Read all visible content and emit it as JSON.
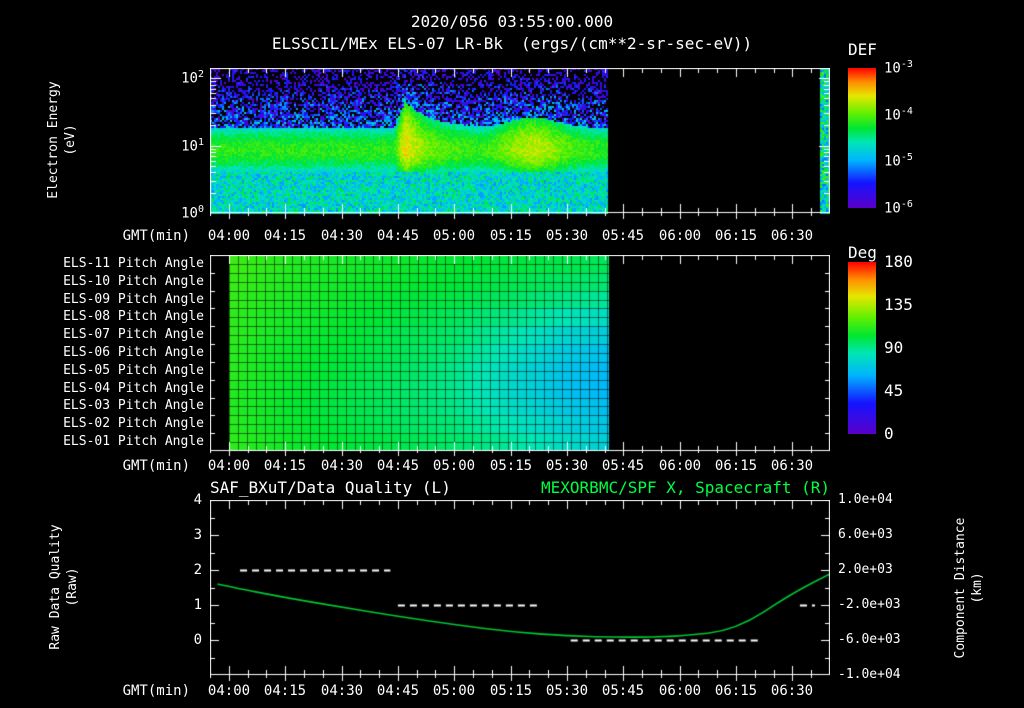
{
  "colors": {
    "background": "#000000",
    "foreground": "#ffffff",
    "accent_green": "#00ff41",
    "curve_green": "#00c832",
    "below_range": "#020208",
    "colormap_stops": [
      {
        "t": 0.0,
        "c": "#5a00c8"
      },
      {
        "t": 0.18,
        "c": "#1414ff"
      },
      {
        "t": 0.34,
        "c": "#00b4ff"
      },
      {
        "t": 0.47,
        "c": "#00e6b4"
      },
      {
        "t": 0.57,
        "c": "#00e632"
      },
      {
        "t": 0.68,
        "c": "#64f000"
      },
      {
        "t": 0.8,
        "c": "#e6e600"
      },
      {
        "t": 0.9,
        "c": "#ff8c00"
      },
      {
        "t": 1.0,
        "c": "#ff0000"
      }
    ]
  },
  "header": {
    "datetime": "2020/056 03:55:00.000",
    "title": "ELSSCIL/MEx ELS-07 LR-Bk",
    "units": "(ergs/(cm**2-sr-sec-eV))"
  },
  "time_axis": {
    "label": "GMT(min)",
    "start_offset_min": -5,
    "end_offset_min": 160,
    "major_tick_interval_min": 15,
    "minor_tick_interval_min": 5,
    "ticks": [
      "04:00",
      "04:15",
      "04:30",
      "04:45",
      "05:00",
      "05:15",
      "05:30",
      "05:45",
      "06:00",
      "06:15",
      "06:30"
    ]
  },
  "spectrogram_panel": {
    "ylabel_line1": "Electron Energy",
    "ylabel_line2": "(eV)",
    "ytick_base": "10",
    "ytick_exponents": [
      "2",
      "1",
      "0"
    ],
    "colorbar_title": "DEF",
    "colorbar_tick_base": "10",
    "colorbar_tick_exponents": [
      "-3",
      "-4",
      "-5",
      "-6"
    ]
  },
  "pitch_panel": {
    "row_labels": [
      "ELS-11 Pitch Angle",
      "ELS-10 Pitch Angle",
      "ELS-09 Pitch Angle",
      "ELS-08 Pitch Angle",
      "ELS-07 Pitch Angle",
      "ELS-06 Pitch Angle",
      "ELS-05 Pitch Angle",
      "ELS-04 Pitch Angle",
      "ELS-03 Pitch Angle",
      "ELS-02 Pitch Angle",
      "ELS-01 Pitch Angle"
    ],
    "colorbar_title": "Deg",
    "colorbar_ticks": [
      "180",
      "135",
      "90",
      "45",
      "0"
    ]
  },
  "timeseries_panel": {
    "title_left": "SAF_BXuT/Data Quality (L)",
    "title_right": "MEXORBMC/SPF X, Spacecraft (R)",
    "ylabel_left_line1": "Raw Data Quality",
    "ylabel_left_line2": "(Raw)",
    "ylabel_right_line1": "Component Distance",
    "ylabel_right_line2": "(km)",
    "left_ticks": [
      "4",
      "3",
      "2",
      "1",
      "0"
    ],
    "right_ticks": [
      "1.0e+04",
      "6.0e+03",
      "2.0e+03",
      "-2.0e+03",
      "-6.0e+03",
      "-1.0e+04"
    ]
  },
  "chart_data": [
    {
      "id": "electron-energy-spectrogram",
      "type": "heatmap",
      "title": "ELSSCIL/MEx ELS-07 LR-Bk",
      "x_axis": {
        "label": "GMT(min)",
        "range_min_since_0400": [
          -5,
          160
        ]
      },
      "y_axis": {
        "label": "Electron Energy (eV)",
        "scale": "log",
        "range_ev": [
          1,
          141
        ],
        "log_range": [
          0,
          2.15
        ]
      },
      "color_axis": {
        "label": "DEF (ergs/(cm**2-sr-sec-eV))",
        "scale": "log",
        "log_range": [
          -6,
          -3
        ]
      },
      "coverage_min": [
        [
          -5,
          101
        ],
        [
          157.5,
          160
        ]
      ],
      "model": {
        "band_center_log_ev": 0.95,
        "band_bottom_log_ev": 0.62,
        "band_top_log_ev": 1.28,
        "band_peak_log_def": -4.15,
        "low_energy_log_def": -4.7,
        "background_log_def": -5.5,
        "noise_band": 0.3,
        "noise_low": 0.8,
        "noise_background": 1.8,
        "flare": {
          "onset_min": 47,
          "rise_min": 3,
          "decay_tau_min": 7,
          "boost_log_def": 0.6,
          "band_top_boost_log_ev": 0.38
        },
        "enhancement": {
          "center_min": 81,
          "sigma_min": 9,
          "boost_log_def": 0.42,
          "band_top_boost_log_ev": 0.15
        }
      }
    },
    {
      "id": "pitch-angle-heatmap",
      "type": "heatmap",
      "rows": [
        "ELS-11",
        "ELS-10",
        "ELS-09",
        "ELS-08",
        "ELS-07",
        "ELS-06",
        "ELS-05",
        "ELS-04",
        "ELS-03",
        "ELS-02",
        "ELS-01"
      ],
      "x_sample_min": [
        0,
        15,
        30,
        45,
        60,
        75,
        90,
        101
      ],
      "values_deg": [
        [
          115,
          110,
          107,
          105,
          103,
          101,
          99,
          97
        ],
        [
          114,
          109,
          106,
          104,
          102,
          99,
          96,
          94
        ],
        [
          113,
          108,
          105,
          102,
          100,
          96,
          91,
          88
        ],
        [
          112,
          107,
          104,
          101,
          97,
          91,
          84,
          80
        ],
        [
          112,
          106,
          103,
          99,
          95,
          86,
          76,
          72
        ],
        [
          111,
          105,
          102,
          98,
          93,
          82,
          71,
          67
        ],
        [
          111,
          105,
          101,
          97,
          91,
          79,
          68,
          64
        ],
        [
          110,
          104,
          100,
          96,
          90,
          78,
          67,
          63
        ],
        [
          110,
          104,
          100,
          96,
          91,
          80,
          70,
          66
        ],
        [
          111,
          105,
          101,
          97,
          93,
          84,
          74,
          69
        ],
        [
          112,
          106,
          102,
          99,
          95,
          88,
          79,
          73
        ]
      ],
      "color_axis": {
        "label": "Deg",
        "range": [
          0,
          180
        ]
      },
      "coverage_min": [
        0,
        101
      ]
    },
    {
      "id": "quality-and-distance",
      "type": "line",
      "x_axis": {
        "label": "GMT(min)",
        "range_min_since_0400": [
          -5,
          160
        ]
      },
      "left_axis": {
        "label": "Raw Data Quality (Raw)",
        "range": [
          -1,
          4
        ],
        "ticks": [
          4,
          3,
          2,
          1,
          0
        ]
      },
      "right_axis": {
        "label": "Component Distance (km)",
        "range": [
          -10000,
          10000
        ],
        "ticks": [
          10000,
          6000,
          2000,
          -2000,
          -6000,
          -10000
        ]
      },
      "series": [
        {
          "name": "SAF_BXuT/Data Quality (L)",
          "axis": "left",
          "color": "#ffffff",
          "style": "dashed",
          "segments": [
            {
              "start_min": 3,
              "end_min": 43,
              "value": 2
            },
            {
              "start_min": 45,
              "end_min": 83,
              "value": 1
            },
            {
              "start_min": 91,
              "end_min": 141,
              "value": 0
            },
            {
              "start_min": 152,
              "end_min": 156,
              "value": 1
            }
          ]
        },
        {
          "name": "MEXORBMC/SPF X, Spacecraft (R)",
          "axis": "right",
          "color": "#00c832",
          "style": "solid",
          "points_min_km": [
            [
              -3,
              400
            ],
            [
              0,
              100
            ],
            [
              15,
              -1150
            ],
            [
              30,
              -2250
            ],
            [
              45,
              -3300
            ],
            [
              60,
              -4250
            ],
            [
              75,
              -5050
            ],
            [
              90,
              -5550
            ],
            [
              105,
              -5700
            ],
            [
              120,
              -5600
            ],
            [
              135,
              -4850
            ],
            [
              150,
              -650
            ],
            [
              160,
              1550
            ]
          ]
        }
      ]
    }
  ]
}
